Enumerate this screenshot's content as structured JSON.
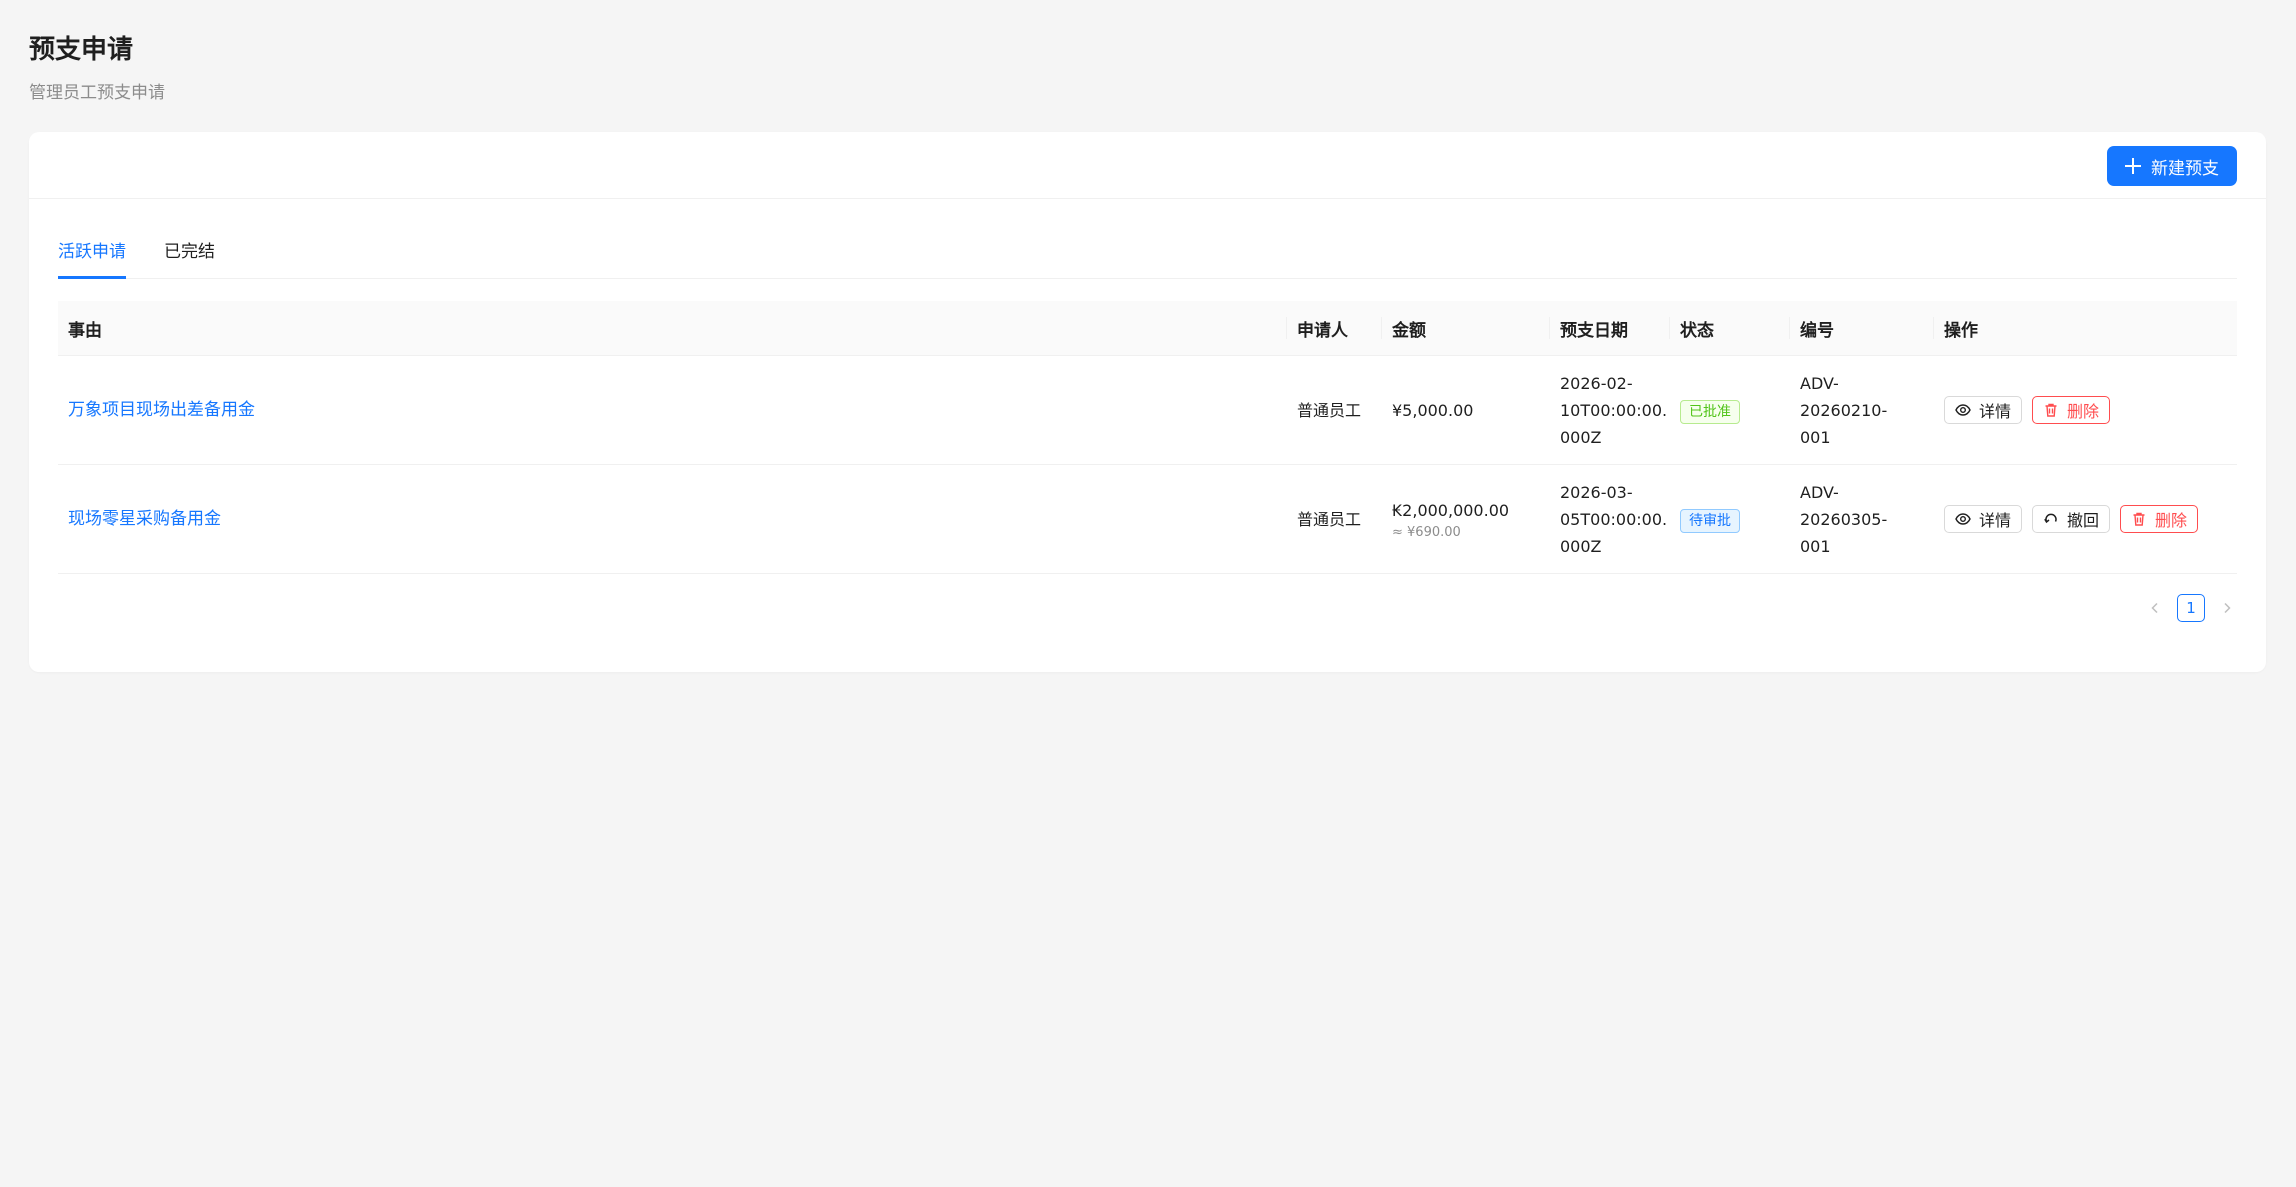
{
  "header": {
    "title": "预支申请",
    "subtitle": "管理员工预支申请"
  },
  "toolbar": {
    "new_label": "新建预支"
  },
  "tabs": [
    {
      "label": "活跃申请",
      "active": true
    },
    {
      "label": "已完结",
      "active": false
    }
  ],
  "table": {
    "columns": [
      "事由",
      "申请人",
      "金额",
      "预支日期",
      "状态",
      "编号",
      "操作"
    ],
    "rows": [
      {
        "reason": "万象项目现场出差备用金",
        "applicant": "普通员工",
        "amount": "¥5,000.00",
        "amount_converted": "",
        "date_line1": "2026-02-",
        "date_line2": "10T00:00:00.",
        "date_line3": "000Z",
        "status": "已批准",
        "id_line1": "ADV-20260210-",
        "id_line2": "001",
        "actions": {
          "detail": "详情",
          "delete": "删除"
        }
      },
      {
        "reason": "现场零星采购备用金",
        "applicant": "普通员工",
        "amount": "₭2,000,000.00",
        "amount_converted": "≈ ¥690.00",
        "date_line1": "2026-03-",
        "date_line2": "05T00:00:00.",
        "date_line3": "000Z",
        "status": "待审批",
        "id_line1": "ADV-20260305-",
        "id_line2": "001",
        "actions": {
          "detail": "详情",
          "withdraw": "撤回",
          "delete": "删除"
        }
      }
    ]
  },
  "pagination": {
    "current": "1",
    "prev_icon": "chevron-left-icon",
    "next_icon": "chevron-right-icon"
  },
  "colors": {
    "primary": "#1677ff",
    "danger": "#ff4d4f",
    "success": "#52c41a"
  }
}
